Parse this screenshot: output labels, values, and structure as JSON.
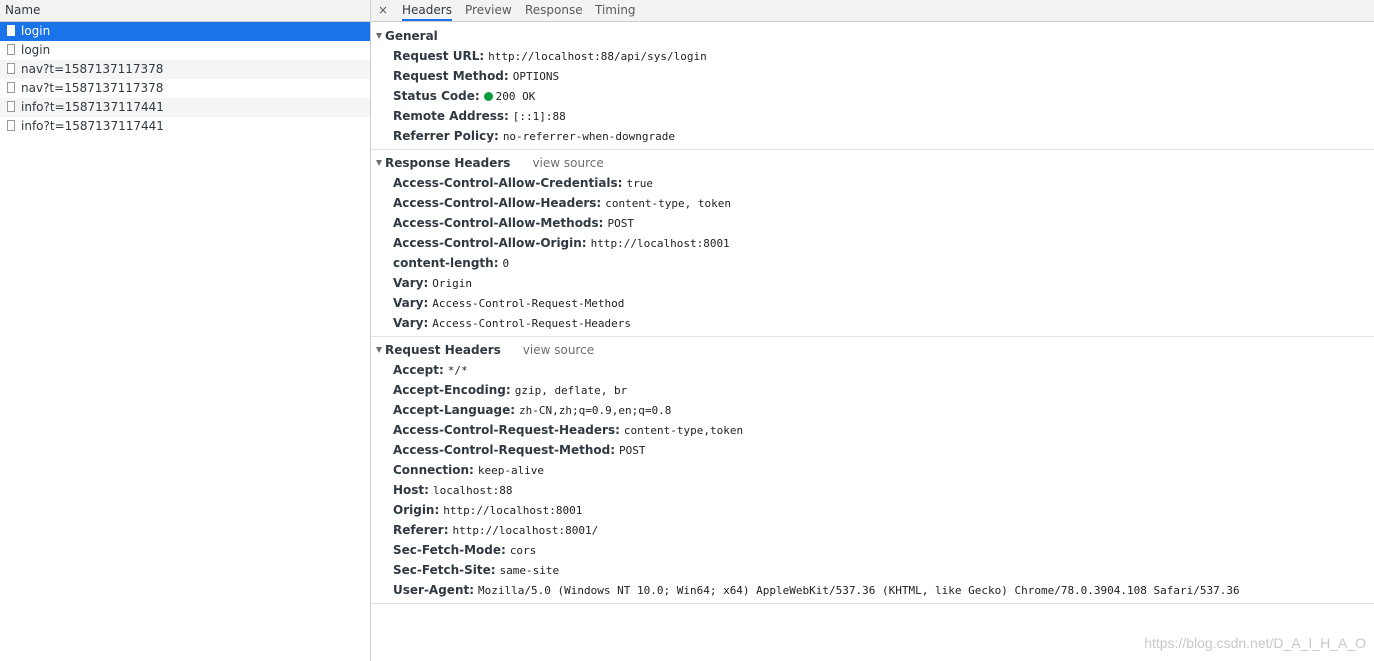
{
  "requests": {
    "header": "Name",
    "items": [
      {
        "name": "login"
      },
      {
        "name": "login"
      },
      {
        "name": "nav?t=1587137117378"
      },
      {
        "name": "nav?t=1587137117378"
      },
      {
        "name": "info?t=1587137117441"
      },
      {
        "name": "info?t=1587137117441"
      }
    ]
  },
  "tabs": {
    "close": "×",
    "items": [
      "Headers",
      "Preview",
      "Response",
      "Timing"
    ]
  },
  "general": {
    "title": "General",
    "rows": [
      {
        "name": "Request URL:",
        "value": "http://localhost:88/api/sys/login"
      },
      {
        "name": "Request Method:",
        "value": "OPTIONS"
      },
      {
        "name": "Status Code:",
        "value": "200 OK"
      },
      {
        "name": "Remote Address:",
        "value": "[::1]:88"
      },
      {
        "name": "Referrer Policy:",
        "value": "no-referrer-when-downgrade"
      }
    ]
  },
  "response_headers": {
    "title": "Response Headers",
    "view_source": "view source",
    "rows": [
      {
        "name": "Access-Control-Allow-Credentials:",
        "value": "true"
      },
      {
        "name": "Access-Control-Allow-Headers:",
        "value": "content-type, token"
      },
      {
        "name": "Access-Control-Allow-Methods:",
        "value": "POST"
      },
      {
        "name": "Access-Control-Allow-Origin:",
        "value": "http://localhost:8001"
      },
      {
        "name": "content-length:",
        "value": "0"
      },
      {
        "name": "Vary:",
        "value": "Origin"
      },
      {
        "name": "Vary:",
        "value": "Access-Control-Request-Method"
      },
      {
        "name": "Vary:",
        "value": "Access-Control-Request-Headers"
      }
    ]
  },
  "request_headers": {
    "title": "Request Headers",
    "view_source": "view source",
    "rows": [
      {
        "name": "Accept:",
        "value": "*/*"
      },
      {
        "name": "Accept-Encoding:",
        "value": "gzip, deflate, br"
      },
      {
        "name": "Accept-Language:",
        "value": "zh-CN,zh;q=0.9,en;q=0.8"
      },
      {
        "name": "Access-Control-Request-Headers:",
        "value": "content-type,token"
      },
      {
        "name": "Access-Control-Request-Method:",
        "value": "POST"
      },
      {
        "name": "Connection:",
        "value": "keep-alive"
      },
      {
        "name": "Host:",
        "value": "localhost:88"
      },
      {
        "name": "Origin:",
        "value": "http://localhost:8001"
      },
      {
        "name": "Referer:",
        "value": "http://localhost:8001/"
      },
      {
        "name": "Sec-Fetch-Mode:",
        "value": "cors"
      },
      {
        "name": "Sec-Fetch-Site:",
        "value": "same-site"
      },
      {
        "name": "User-Agent:",
        "value": "Mozilla/5.0 (Windows NT 10.0; Win64; x64) AppleWebKit/537.36 (KHTML, like Gecko) Chrome/78.0.3904.108 Safari/537.36"
      }
    ]
  },
  "watermark": "https://blog.csdn.net/D_A_I_H_A_O",
  "colors": {
    "accent": "#1a73e8",
    "status_ok": "#0a9d3d"
  }
}
